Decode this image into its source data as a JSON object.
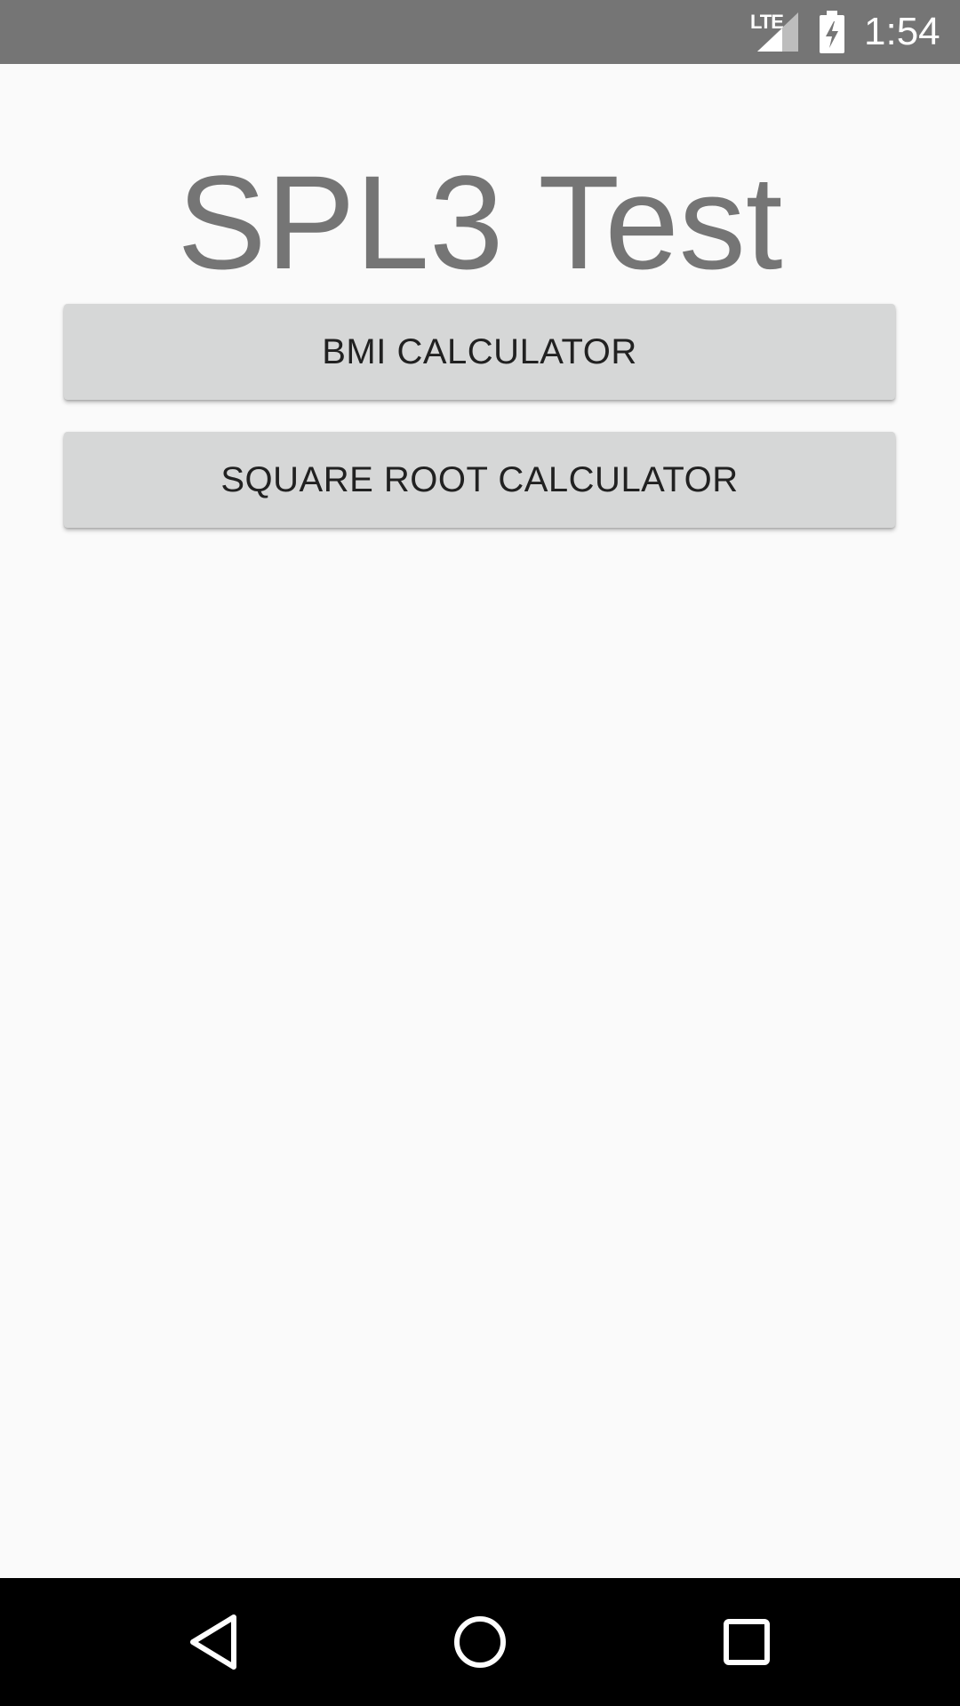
{
  "status_bar": {
    "network_label": "LTE",
    "time": "1:54",
    "icons": [
      "signal-icon",
      "battery-charging-icon"
    ]
  },
  "main": {
    "title": "SPL3 Test",
    "buttons": [
      {
        "label": "BMI CALCULATOR"
      },
      {
        "label": "SQUARE ROOT CALCULATOR"
      }
    ]
  },
  "nav_bar": {
    "icons": [
      "back-icon",
      "home-icon",
      "recents-icon"
    ]
  },
  "colors": {
    "status_bar_bg": "#757575",
    "background": "#fafafa",
    "title_text": "#757575",
    "button_bg": "#d6d7d7",
    "button_text": "#212121",
    "nav_bar_bg": "#000000"
  }
}
